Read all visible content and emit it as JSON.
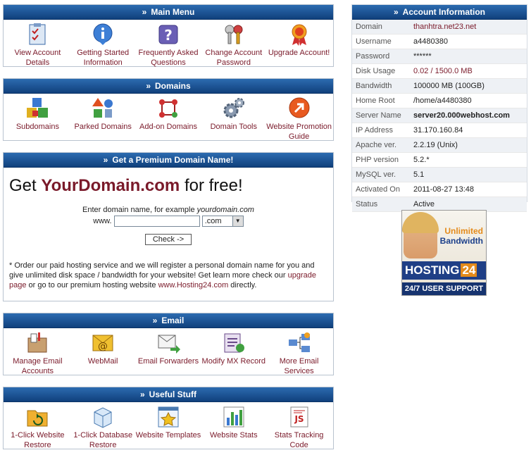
{
  "main_menu": {
    "title": "Main Menu",
    "items": [
      {
        "label": "View Account Details",
        "icon": "checklist-icon"
      },
      {
        "label": "Getting Started Information",
        "icon": "info-icon"
      },
      {
        "label": "Frequently Asked Questions",
        "icon": "question-icon"
      },
      {
        "label": "Change Account Password",
        "icon": "keys-icon"
      },
      {
        "label": "Upgrade Account!",
        "icon": "ribbon-award-icon"
      }
    ]
  },
  "domains": {
    "title": "Domains",
    "items": [
      {
        "label": "Subdomains",
        "icon": "cubes-icon"
      },
      {
        "label": "Parked Domains",
        "icon": "shapes-icon"
      },
      {
        "label": "Add-on Domains",
        "icon": "network-nodes-icon"
      },
      {
        "label": "Domain Tools",
        "icon": "gears-icon"
      },
      {
        "label": "Website Promotion Guide",
        "icon": "arrow-circle-icon"
      }
    ]
  },
  "premium": {
    "title": "Get a Premium Domain Name!",
    "headline_pre": "Get ",
    "headline_brand": "YourDomain.com",
    "headline_post": " for free!",
    "enter_text": "Enter domain name, for example ",
    "example": "yourdomain.com",
    "www_label": "www.",
    "input_value": "",
    "tld_selected": ".com",
    "check_label": "Check ->",
    "note_1": "* Order our paid hosting service and we will register a personal domain name for you and give unlimited disk space / bandwidth for your website! Get learn more check our ",
    "note_link_1": "upgrade page",
    "note_2": " or go to our premium hosting website ",
    "note_link_2": "www.Hosting24.com",
    "note_3": " directly."
  },
  "email": {
    "title": "Email",
    "items": [
      {
        "label": "Manage Email Accounts",
        "icon": "mailbox-icon"
      },
      {
        "label": "WebMail",
        "icon": "at-envelope-icon"
      },
      {
        "label": "Email Forwarders",
        "icon": "envelope-forward-icon"
      },
      {
        "label": "Modify MX Record",
        "icon": "mx-record-icon"
      },
      {
        "label": "More Email Services",
        "icon": "mail-services-icon"
      }
    ]
  },
  "useful": {
    "title": "Useful Stuff",
    "items": [
      {
        "label": "1-Click Website Restore",
        "icon": "folder-restore-icon"
      },
      {
        "label": "1-Click Database Restore",
        "icon": "database-box-icon"
      },
      {
        "label": "Website Templates",
        "icon": "template-star-icon"
      },
      {
        "label": "Website Stats",
        "icon": "bar-stats-icon"
      },
      {
        "label": "Stats Tracking Code",
        "icon": "js-code-icon"
      }
    ]
  },
  "account": {
    "title": "Account Information",
    "rows": [
      {
        "key": "Domain",
        "value": "thanhtra.net23.net"
      },
      {
        "key": "Username",
        "value": "a4480380"
      },
      {
        "key": "Password",
        "value": "******"
      },
      {
        "key": "Disk Usage",
        "value": "0.02 / 1500.0 MB"
      },
      {
        "key": "Bandwidth",
        "value": "100000 MB (100GB)"
      },
      {
        "key": "Home Root",
        "value": "/home/a4480380"
      },
      {
        "key": "Server Name",
        "value": "server20.000webhost.com"
      },
      {
        "key": "IP Address",
        "value": "31.170.160.84"
      },
      {
        "key": "Apache ver.",
        "value": "2.2.19 (Unix)"
      },
      {
        "key": "PHP version",
        "value": "5.2.*"
      },
      {
        "key": "MySQL ver.",
        "value": "5.1"
      },
      {
        "key": "Activated On",
        "value": "2011-08-27 13:48"
      },
      {
        "key": "Status",
        "value": "Active"
      }
    ]
  },
  "banner": {
    "line1": "Unlimited",
    "line2": "Bandwidth",
    "brand": "HOSTING",
    "brand_num": "24",
    "support": "24/7 USER SUPPORT"
  },
  "colors": {
    "header_dark": "#10407c",
    "header_light": "#2c6bb0",
    "link": "#7a1a2a"
  }
}
